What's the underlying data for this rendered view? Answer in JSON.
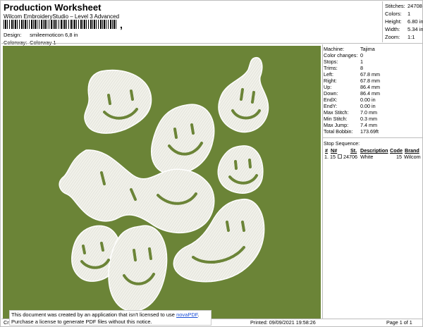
{
  "header": {
    "title": "Production Worksheet",
    "subtitle": "Wilcom EmbroideryStudio – Level 3 Advanced",
    "design_label": "Design:",
    "design_value": "smileemoticon 6,8 in",
    "colorway_label": "Colorway:",
    "colorway_value": "Colorway 1"
  },
  "stats": [
    {
      "label": "Stitches:",
      "value": "24708"
    },
    {
      "label": "Colors:",
      "value": "1"
    },
    {
      "label": "Height:",
      "value": "6.80 in"
    },
    {
      "label": "Width:",
      "value": "5.34 in"
    },
    {
      "label": "Zoom:",
      "value": "1:1"
    }
  ],
  "machine_info": [
    {
      "label": "Machine:",
      "value": "Tajima"
    },
    {
      "label": "Color changes:",
      "value": "0"
    },
    {
      "label": "Stops:",
      "value": "1"
    },
    {
      "label": "Trims:",
      "value": "8"
    },
    {
      "label": "Left:",
      "value": "67.8 mm"
    },
    {
      "label": "Right:",
      "value": "67.8 mm"
    },
    {
      "label": "Up:",
      "value": "86.4 mm"
    },
    {
      "label": "Down:",
      "value": "86.4 mm"
    },
    {
      "label": "EndX:",
      "value": "0.00 in"
    },
    {
      "label": "EndY:",
      "value": "0.00 in"
    },
    {
      "label": "Max Stitch:",
      "value": "7.0 mm"
    },
    {
      "label": "Min Stitch:",
      "value": "0.3 mm"
    },
    {
      "label": "Max Jump:",
      "value": "7.4 mm"
    },
    {
      "label": "Total Bobbin:",
      "value": "173.69ft"
    }
  ],
  "stop_sequence": {
    "title": "Stop Sequence:",
    "headers": {
      "num": "#",
      "n": "N#",
      "st": "St.",
      "description": "Description",
      "code": "Code",
      "brand": "Brand"
    },
    "rows": [
      {
        "num": "1.",
        "n": "15",
        "st": "24706",
        "description": "White",
        "code": "15",
        "brand": "Wilcom"
      }
    ]
  },
  "footer": {
    "left": "Cr",
    "printed": "Printed: 09/09/2021 19:58:26",
    "page": "Page 1 of 1"
  },
  "notice": {
    "line1_pre": "This document was created by an application that isn't licensed to use ",
    "link": "novaPDF",
    "line1_post": ".",
    "line2": "Purchase a license to generate PDF files without this notice."
  },
  "colors": {
    "fabric": "#6b8437",
    "thread": "#f1f1ea"
  }
}
